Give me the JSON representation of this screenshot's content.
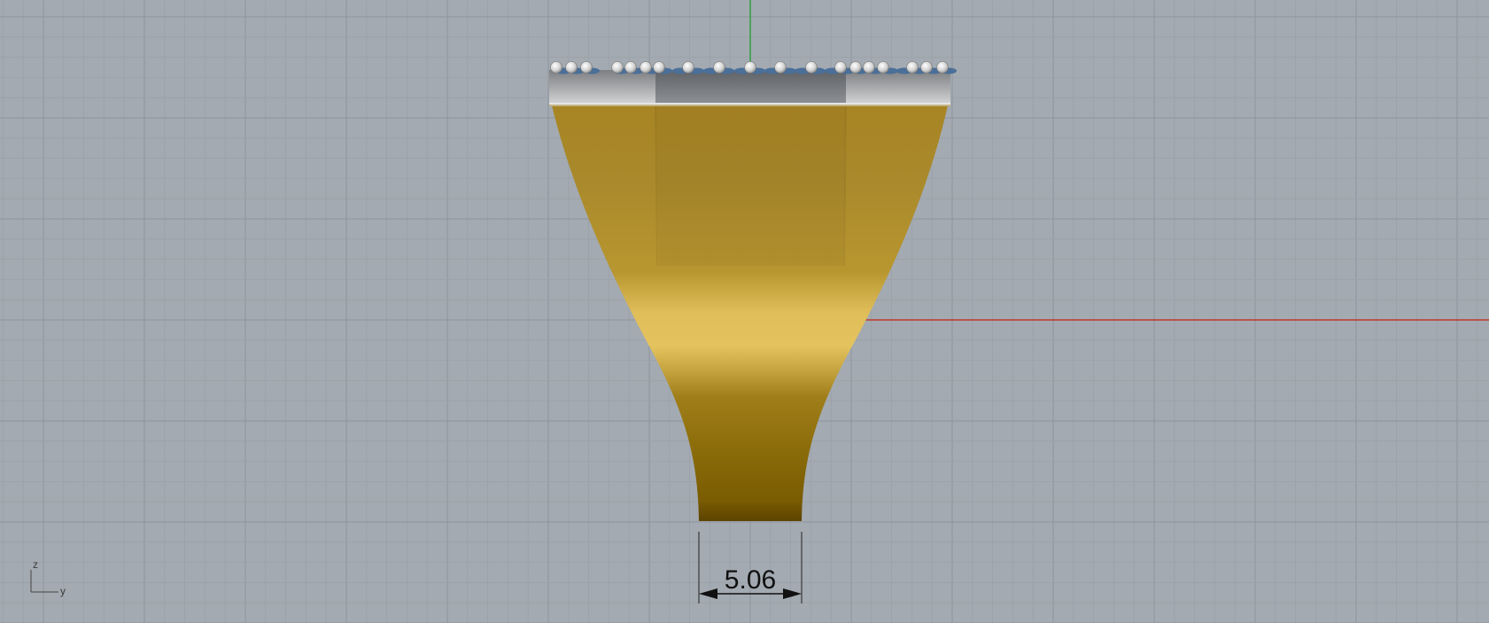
{
  "viewport": {
    "background": "#a3aab1",
    "grid_minor_color": "#9aa1a8",
    "grid_major_color": "#8e949b",
    "x_axis_color": "#c0392b",
    "y_axis_color": "#2ea043"
  },
  "model": {
    "band_gold_light": "#e2c25e",
    "band_gold_mid": "#b8922d",
    "band_gold_dark": "#6f5200",
    "metal_head_color": "#c9c9c9",
    "stone_color": "#4a6f99"
  },
  "dimension": {
    "value": "5.06"
  },
  "axis_widget": {
    "vertical_label": "z",
    "horizontal_label": "y"
  }
}
